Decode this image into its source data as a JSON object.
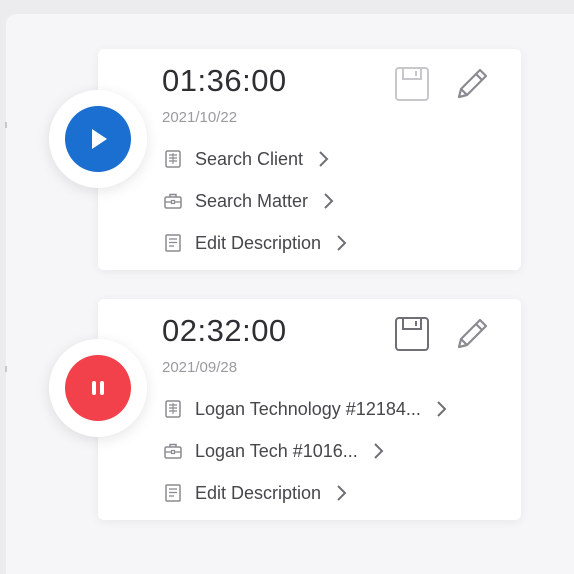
{
  "colors": {
    "play": "#1a6fd1",
    "pause": "#f2414a",
    "icon_stroke": "#8a8a90",
    "save_icon_disabled": "#c7c7cc"
  },
  "timers": [
    {
      "time": "01:36:00",
      "date": "2021/10/22",
      "state_icon": "play-icon",
      "save_enabled": false,
      "rows": [
        {
          "icon": "building-icon",
          "label": "Search Client"
        },
        {
          "icon": "briefcase-icon",
          "label": "Search Matter"
        },
        {
          "icon": "document-icon",
          "label": "Edit Description"
        }
      ]
    },
    {
      "time": "02:32:00",
      "date": "2021/09/28",
      "state_icon": "pause-icon",
      "save_enabled": true,
      "rows": [
        {
          "icon": "building-icon",
          "label": "Logan Technology #12184..."
        },
        {
          "icon": "briefcase-icon",
          "label": "Logan Tech #1016..."
        },
        {
          "icon": "document-icon",
          "label": "Edit Description"
        }
      ]
    }
  ]
}
